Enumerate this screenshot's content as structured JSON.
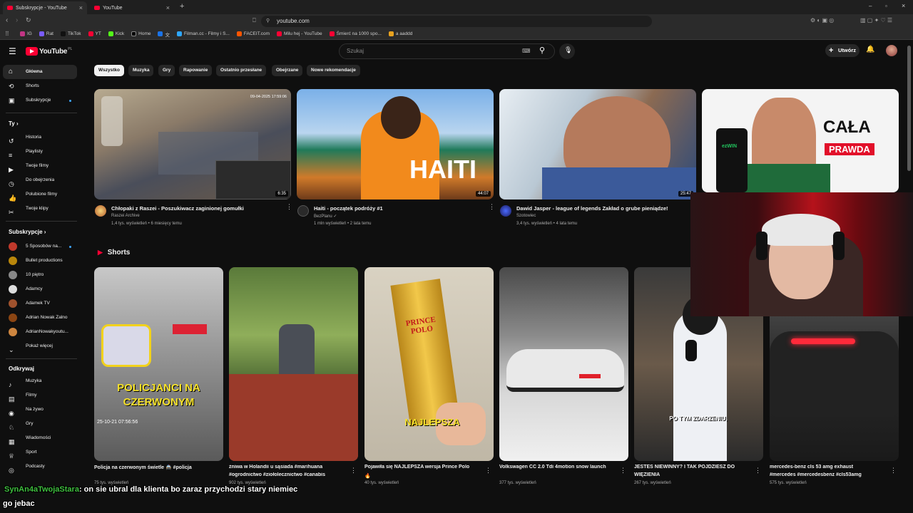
{
  "browser": {
    "tabs": [
      {
        "label": "Subskrypcje - YouTube"
      },
      {
        "label": "YouTube"
      }
    ],
    "url": "youtube.com",
    "bookmarks": [
      "IG",
      "Rat",
      "TikTok",
      "YT",
      "Kick",
      "Home",
      "文",
      "Filman.cc - Filmy i S...",
      "FACEIT.com",
      "Milu hej - YouTube",
      "Śmierć na 1000 spo...",
      "a aaddd"
    ]
  },
  "header": {
    "logo": "YouTube",
    "logo_region": "PL",
    "search_placeholder": "Szukaj",
    "create_label": "Utwórz"
  },
  "sidebar": {
    "main": [
      {
        "label": "Główna",
        "icon": "home-icon",
        "active": true
      },
      {
        "label": "Shorts",
        "icon": "shorts-icon"
      },
      {
        "label": "Subskrypcje",
        "icon": "subscriptions-icon"
      }
    ],
    "you_header": "Ty",
    "you": [
      {
        "label": "Historia",
        "icon": "history-icon"
      },
      {
        "label": "Playlisty",
        "icon": "playlist-icon"
      },
      {
        "label": "Twoje filmy",
        "icon": "video-icon"
      },
      {
        "label": "Do obejrzenia",
        "icon": "clock-icon"
      },
      {
        "label": "Polubione filmy",
        "icon": "like-icon"
      },
      {
        "label": "Twoje klipy",
        "icon": "scissors-icon"
      }
    ],
    "subs_header": "Subskrypcje",
    "subs": [
      {
        "label": "5 Sposobów na...",
        "color": "#c0392b"
      },
      {
        "label": "Bullet productions",
        "color": "#b8860b"
      },
      {
        "label": "10 piętro",
        "color": "#888888"
      },
      {
        "label": "Adamcy",
        "color": "#dddddd"
      },
      {
        "label": "Adamek TV",
        "color": "#a0522d"
      },
      {
        "label": "Adrian Nowak Zalno",
        "color": "#8b4513"
      },
      {
        "label": "AdrianNowakyoutu...",
        "color": "#cd853f"
      }
    ],
    "show_more": "Pokaż więcej",
    "explore_header": "Odkrywaj",
    "explore": [
      {
        "label": "Muzyka",
        "icon": "music-icon"
      },
      {
        "label": "Filmy",
        "icon": "film-icon"
      },
      {
        "label": "Na żywo",
        "icon": "live-icon"
      },
      {
        "label": "Gry",
        "icon": "game-icon"
      },
      {
        "label": "Wiadomości",
        "icon": "news-icon"
      },
      {
        "label": "Sport",
        "icon": "trophy-icon"
      },
      {
        "label": "Podcasty",
        "icon": "podcast-icon"
      }
    ]
  },
  "chips": [
    "Wszystko",
    "Muzyka",
    "Gry",
    "Rapowanie",
    "Ostatnio przesłane",
    "Obejrzane",
    "Nowe rekomendacje"
  ],
  "videos": [
    {
      "title": "Chłopaki z Raszei - Poszukiwacz zaginionej gomułki",
      "channel": "Raszei Archive",
      "meta": "1,4 tys. wyświetleń • 6 miesięcy temu",
      "duration": "6:35",
      "thumb_date": "09-04-2025 17:59:06"
    },
    {
      "title": "Haiti - początek podróży #1",
      "channel": "BezPlanu",
      "meta": "1 mln wyświetleń • 2 lata temu",
      "duration": "44:07",
      "thumb_text": "HAITI"
    },
    {
      "title": "Dawid Jasper - league of legends Zakład o grube pieniądze!",
      "channel": "Szotowiec",
      "meta": "3,4 tys. wyświetleń • 4 lata temu",
      "duration": "25:47"
    },
    {
      "thumb_text_1": "CAŁA",
      "thumb_text_2": "PRAWDA",
      "thumb_brand": "ezWIN"
    }
  ],
  "shorts_header": "Shorts",
  "shorts": [
    {
      "title": "Policja na czerwonym świetle 🚔 #policja",
      "views": "75 tys. wyświetleń",
      "thumb_text": "POLICJANCI NA CZERWONYM",
      "thumb_stamp": "25-10-21 07:56:56"
    },
    {
      "title": "żniwa w Holandii u sąsiada #marihuana",
      "title_2": "#ogrodnictwo #ziołolecznictwo #canabis",
      "views": "902 tys. wyświetleń"
    },
    {
      "title": "Pojawiła się NAJLEPSZA wersja Prince Polo",
      "views": "40 tys. wyświetleń",
      "thumb_text": "NAJLEPSZA",
      "thumb_brand": "PRINCE POLO"
    },
    {
      "title": "Volkswagen CC 2.0 Tdi 4motion snow launch",
      "views": "377 tys. wyświetleń"
    },
    {
      "title": "JESTEŚ NIEWINNY? I TAK PÓJDZIESZ DO",
      "title_2": "WIĘZIENIA",
      "views": "267 tys. wyświetleń",
      "thumb_text": "PO TYM ZDARZENIU,"
    },
    {
      "title": "mercedes-benz cls 53 amg exhaust",
      "title_2": "#mercedes #mercedesbenz #cls53amg",
      "views": "575 tys. wyświetleń"
    }
  ],
  "chat": [
    {
      "name": "SynAn4aTwojaStara",
      "text": ": on sie ubral dla klienta bo zaraz przychodzi stary niemiec"
    },
    {
      "name": "",
      "text": "go jebac"
    }
  ]
}
